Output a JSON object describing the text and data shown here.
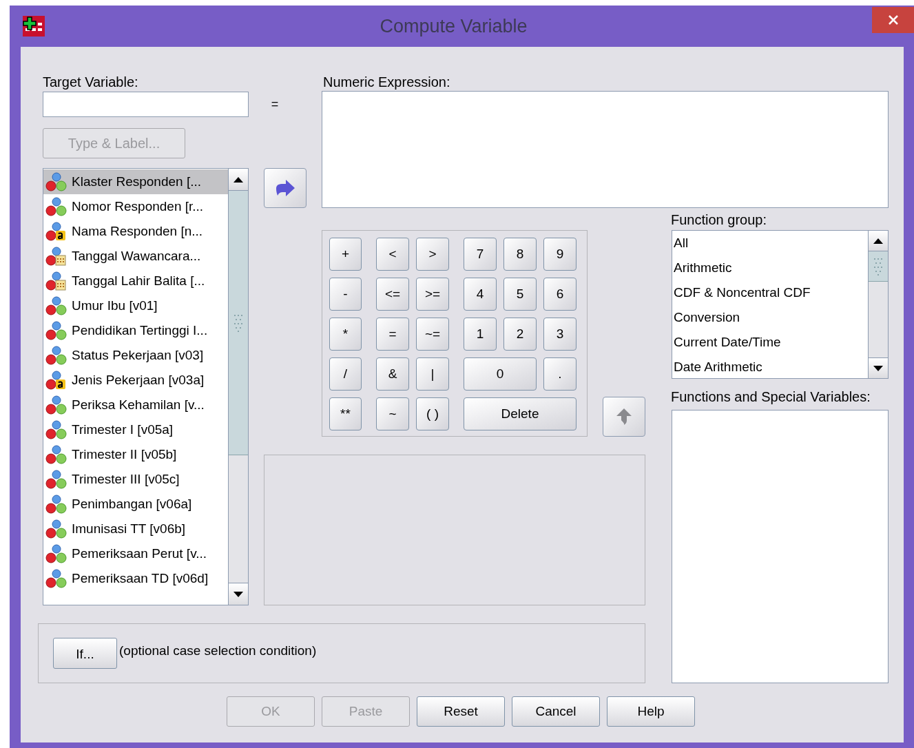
{
  "window": {
    "title": "Compute Variable"
  },
  "target_variable": {
    "label": "Target Variable:"
  },
  "equals_sign": "=",
  "type_label_button": {
    "label": "Type & Label...",
    "disabled": true
  },
  "variables": [
    {
      "name": "Klaster Responden [...",
      "kind": "numeric",
      "selected": true
    },
    {
      "name": "Nomor Responden [r...",
      "kind": "numeric",
      "selected": false
    },
    {
      "name": "Nama Responden [n...",
      "kind": "string",
      "selected": false
    },
    {
      "name": "Tanggal Wawancara...",
      "kind": "date",
      "selected": false
    },
    {
      "name": "Tanggal Lahir Balita [...",
      "kind": "date",
      "selected": false
    },
    {
      "name": "Umur Ibu [v01]",
      "kind": "numeric",
      "selected": false
    },
    {
      "name": "Pendidikan Tertinggi I...",
      "kind": "numeric",
      "selected": false
    },
    {
      "name": "Status Pekerjaan [v03]",
      "kind": "numeric",
      "selected": false
    },
    {
      "name": "Jenis Pekerjaan [v03a]",
      "kind": "string",
      "selected": false
    },
    {
      "name": "Periksa Kehamilan [v...",
      "kind": "numeric",
      "selected": false
    },
    {
      "name": "Trimester I [v05a]",
      "kind": "numeric",
      "selected": false
    },
    {
      "name": "Trimester II [v05b]",
      "kind": "numeric",
      "selected": false
    },
    {
      "name": "Trimester III [v05c]",
      "kind": "numeric",
      "selected": false
    },
    {
      "name": "Penimbangan [v06a]",
      "kind": "numeric",
      "selected": false
    },
    {
      "name": "Imunisasi TT [v06b]",
      "kind": "numeric",
      "selected": false
    },
    {
      "name": "Pemeriksaan Perut [v...",
      "kind": "numeric",
      "selected": false
    },
    {
      "name": "Pemeriksaan TD [v06d]",
      "kind": "numeric",
      "selected": false
    }
  ],
  "numeric_expression": {
    "label": "Numeric Expression:"
  },
  "keypad": {
    "rows": [
      {
        "keys": [
          {
            "label": "+",
            "kind": "single"
          },
          {
            "label": "<",
            "kind": "single"
          },
          {
            "label": ">",
            "kind": "single"
          },
          {
            "label": "7",
            "kind": "single"
          },
          {
            "label": "8",
            "kind": "single"
          },
          {
            "label": "9",
            "kind": "single"
          }
        ]
      },
      {
        "keys": [
          {
            "label": "-",
            "kind": "single"
          },
          {
            "label": "<=",
            "kind": "single"
          },
          {
            "label": ">=",
            "kind": "single"
          },
          {
            "label": "4",
            "kind": "single"
          },
          {
            "label": "5",
            "kind": "single"
          },
          {
            "label": "6",
            "kind": "single"
          }
        ]
      },
      {
        "keys": [
          {
            "label": "*",
            "kind": "single"
          },
          {
            "label": "=",
            "kind": "single"
          },
          {
            "label": "~=",
            "kind": "single"
          },
          {
            "label": "1",
            "kind": "single"
          },
          {
            "label": "2",
            "kind": "single"
          },
          {
            "label": "3",
            "kind": "single"
          }
        ]
      },
      {
        "keys": [
          {
            "label": "/",
            "kind": "single"
          },
          {
            "label": "&",
            "kind": "single"
          },
          {
            "label": "|",
            "kind": "single"
          },
          {
            "label": "0",
            "kind": "double"
          },
          {
            "label": ".",
            "kind": "single"
          }
        ]
      },
      {
        "keys": [
          {
            "label": "**",
            "kind": "single"
          },
          {
            "label": "~",
            "kind": "single"
          },
          {
            "label": "( )",
            "kind": "single"
          },
          {
            "label": "Delete",
            "kind": "triple"
          }
        ]
      }
    ]
  },
  "function_group": {
    "label": "Function group:",
    "items": [
      {
        "label": "All"
      },
      {
        "label": "Arithmetic"
      },
      {
        "label": "CDF & Noncentral CDF"
      },
      {
        "label": "Conversion"
      },
      {
        "label": "Current Date/Time"
      },
      {
        "label": "Date Arithmetic"
      }
    ]
  },
  "functions": {
    "label": "Functions and Special Variables:"
  },
  "if_button": {
    "label": "If..."
  },
  "if_note": "(optional case selection condition)",
  "buttons": [
    {
      "label": "OK",
      "disabled": true
    },
    {
      "label": "Paste",
      "disabled": true
    },
    {
      "label": "Reset",
      "disabled": false
    },
    {
      "label": "Cancel",
      "disabled": false
    },
    {
      "label": "Help",
      "disabled": false
    }
  ]
}
